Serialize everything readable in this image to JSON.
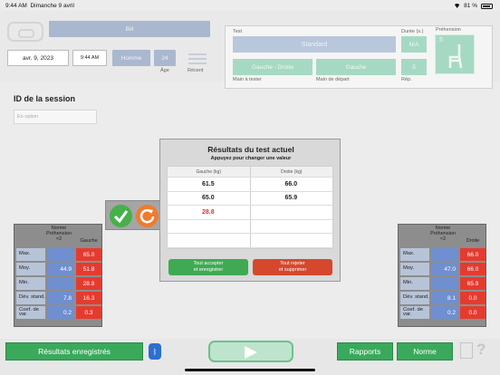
{
  "status": {
    "time": "9:44 AM",
    "date": "Dimanche 9 avril",
    "battery": "81 %"
  },
  "header": {
    "patient": "Bill",
    "date": "avr. 9, 2023",
    "time": "9:44 AM",
    "sex": "Homme",
    "age": "24",
    "age_label": "Âge",
    "recent_label": "Récent"
  },
  "test": {
    "label": "Test",
    "value": "Standard",
    "duration_label": "Durée (s.)",
    "duration": "N/A",
    "grip_label": "Préhension",
    "grip": "5",
    "hand": "Gauche - Droite",
    "hand_label": "Main à tester",
    "start_hand": "Gauche",
    "start_hand_label": "Main de départ",
    "reps": "5",
    "reps_label": "Rép."
  },
  "session": {
    "title": "ID de la session",
    "placeholder": "En option"
  },
  "results": {
    "title": "Résultats du test actuel",
    "subtitle": "Appuyez pour changer une valeur",
    "col_left": "Gauche (kg)",
    "col_right": "Droite (kg)",
    "rows": [
      {
        "left": "61.5",
        "right": "66.0"
      },
      {
        "left": "65.0",
        "right": "65.9"
      },
      {
        "left": "28.8",
        "right": ""
      },
      {
        "left": "",
        "right": ""
      },
      {
        "left": "",
        "right": ""
      }
    ],
    "accept": [
      "Tout accepter",
      "et enregistrer"
    ],
    "reject": [
      "Tout rejeter",
      "et supprimer"
    ]
  },
  "norm_left": {
    "title": "Norme",
    "sub1": "Préhension",
    "sub2": "×2",
    "col": "Gauche",
    "rows": [
      {
        "label": "Max.",
        "norm": "",
        "val": "65.0"
      },
      {
        "label": "Moy.",
        "norm": "44.9",
        "val": "51.8"
      },
      {
        "label": "Min.",
        "norm": "",
        "val": "28.8"
      },
      {
        "label": "Dév. stand.",
        "norm": "7.8",
        "val": "16.3"
      },
      {
        "label": "Coef. de var.",
        "norm": "0.2",
        "val": "0.3"
      }
    ]
  },
  "norm_right": {
    "title": "Norme",
    "sub1": "Préhension",
    "sub2": "×2",
    "col": "Droite",
    "rows": [
      {
        "label": "Max.",
        "norm": "",
        "val": "66.0"
      },
      {
        "label": "Moy.",
        "norm": "47.0",
        "val": "66.0"
      },
      {
        "label": "Min.",
        "norm": "",
        "val": "65.9"
      },
      {
        "label": "Dév. stand.",
        "norm": "8.1",
        "val": "0.0"
      },
      {
        "label": "Coef. de var.",
        "norm": "0.2",
        "val": "0.0"
      }
    ]
  },
  "footer": {
    "saved": "Résultats enregistrés",
    "bluetooth": "ᛒ",
    "reports": "Rapports",
    "norm": "Norme",
    "help": "?"
  },
  "colors": {
    "accent_green": "#3aa95c",
    "red": "#e53b2f",
    "blue": "#6f8fd0"
  }
}
